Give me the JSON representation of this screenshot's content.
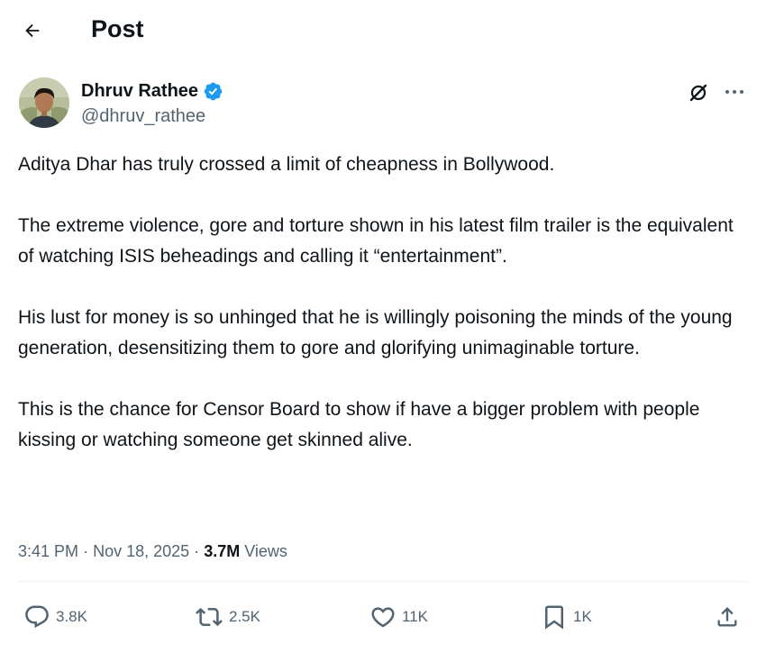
{
  "header": {
    "title": "Post",
    "back_icon": "arrow-left-icon"
  },
  "post": {
    "author": {
      "name": "Dhruv Rathee",
      "handle": "@dhruv_rathee",
      "verified_icon": "verified-badge-icon",
      "verified_color": "#1d9bf0"
    },
    "text": [
      "Aditya Dhar has truly crossed a limit of cheapness in Bollywood.",
      "The extreme violence, gore and torture  shown in his latest film trailer is the equivalent of watching ISIS beheadings and calling it “entertainment”.",
      "His lust for money is so unhinged that he is willingly poisoning the minds of the young generation, desensitizing them to gore and glorifying unimaginable torture.",
      "This is the chance for Censor Board to show if have a bigger problem with people kissing or watching someone get skinned alive."
    ],
    "meta": {
      "time": "3:41 PM",
      "separator": "·",
      "date": "Nov 18, 2025",
      "views_count": "3.7M",
      "views_label": "Views"
    },
    "actions": {
      "replies": "3.8K",
      "reposts": "2.5K",
      "likes": "11K",
      "bookmarks": "1K"
    }
  },
  "colors": {
    "text_primary": "#0f1419",
    "text_secondary": "#536471",
    "accent": "#1d9bf0",
    "divider": "#eff3f4"
  }
}
